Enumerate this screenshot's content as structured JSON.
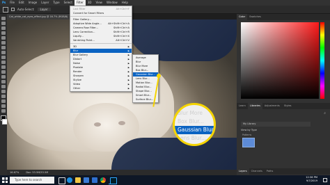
{
  "menubar": {
    "items": [
      "Ps",
      "File",
      "Edit",
      "Image",
      "Layer",
      "Type",
      "Select",
      "Filter",
      "3D",
      "View",
      "Window",
      "Help"
    ]
  },
  "optionsbar": {
    "auto_select_label": "Auto-Select:",
    "auto_select_value": "Layer"
  },
  "document": {
    "tab_title": "Cat_white_cat_eyes_effect.jpg @ 16.7% (RGB/8)"
  },
  "status": {
    "zoom": "16.67%",
    "doc_info": "Doc: 53.5M/53.5M"
  },
  "filter_menu": {
    "items": [
      {
        "label": "Last Filter",
        "shortcut": "Alt+Ctrl+F",
        "state": "disabled"
      },
      {
        "label": "Convert for Smart Filters",
        "state": "normal",
        "sep_after": true
      },
      {
        "label": "Filter Gallery...",
        "state": "normal"
      },
      {
        "label": "Adaptive Wide Angle...",
        "shortcut": "Alt+Shift+Ctrl+A",
        "state": "normal"
      },
      {
        "label": "Camera Raw Filter...",
        "shortcut": "Shift+Ctrl+A",
        "state": "normal"
      },
      {
        "label": "Lens Correction...",
        "shortcut": "Shift+Ctrl+R",
        "state": "normal"
      },
      {
        "label": "Liquify...",
        "shortcut": "Shift+Ctrl+X",
        "state": "normal"
      },
      {
        "label": "Vanishing Point...",
        "shortcut": "Alt+Ctrl+V",
        "state": "normal",
        "sep_after": true
      },
      {
        "label": "3D",
        "state": "normal",
        "submenu": true
      },
      {
        "label": "Blur",
        "state": "highlighted",
        "submenu": true
      },
      {
        "label": "Blur Gallery",
        "state": "normal",
        "submenu": true
      },
      {
        "label": "Distort",
        "state": "normal",
        "submenu": true
      },
      {
        "label": "Noise",
        "state": "normal",
        "submenu": true
      },
      {
        "label": "Pixelate",
        "state": "normal",
        "submenu": true
      },
      {
        "label": "Render",
        "state": "normal",
        "submenu": true
      },
      {
        "label": "Sharpen",
        "state": "normal",
        "submenu": true
      },
      {
        "label": "Stylize",
        "state": "normal",
        "submenu": true
      },
      {
        "label": "Video",
        "state": "normal",
        "submenu": true
      },
      {
        "label": "Other",
        "state": "normal",
        "submenu": true
      }
    ]
  },
  "blur_submenu": {
    "items": [
      {
        "label": "Average",
        "state": "normal"
      },
      {
        "label": "Blur",
        "state": "normal"
      },
      {
        "label": "Blur More",
        "state": "normal"
      },
      {
        "label": "Box Blur...",
        "state": "normal"
      },
      {
        "label": "Gaussian Blur...",
        "state": "highlighted"
      },
      {
        "label": "Lens Blur...",
        "state": "normal"
      },
      {
        "label": "Motion Blur...",
        "state": "normal"
      },
      {
        "label": "Radial Blur...",
        "state": "normal"
      },
      {
        "label": "Shape Blur...",
        "state": "normal"
      },
      {
        "label": "Smart Blur...",
        "state": "normal"
      },
      {
        "label": "Surface Blur...",
        "state": "normal"
      }
    ]
  },
  "magnifier": {
    "items": [
      {
        "label": "Blur More",
        "state": "normal"
      },
      {
        "label": "Box Blur...",
        "state": "normal"
      },
      {
        "label": "Gaussian Blur",
        "state": "highlighted"
      },
      {
        "label": "Lens Blur...",
        "state": "normal"
      }
    ]
  },
  "panels": {
    "top_tabs": [
      "Color",
      "Swatches"
    ],
    "mid_tabs": [
      "Learn",
      "Libraries",
      "Adjustments",
      "Styles"
    ],
    "library_name": "My Library",
    "view_by": "View by Type",
    "group_label": "Patterns",
    "bottom_tabs": [
      "Layers",
      "Channels",
      "Paths"
    ]
  },
  "taskbar": {
    "search_placeholder": "Type here to search",
    "time": "12:36 PM",
    "date": "9/7/2019"
  },
  "colors": {
    "accent": "#0b63c2",
    "highlight_ring": "#f5d400"
  }
}
